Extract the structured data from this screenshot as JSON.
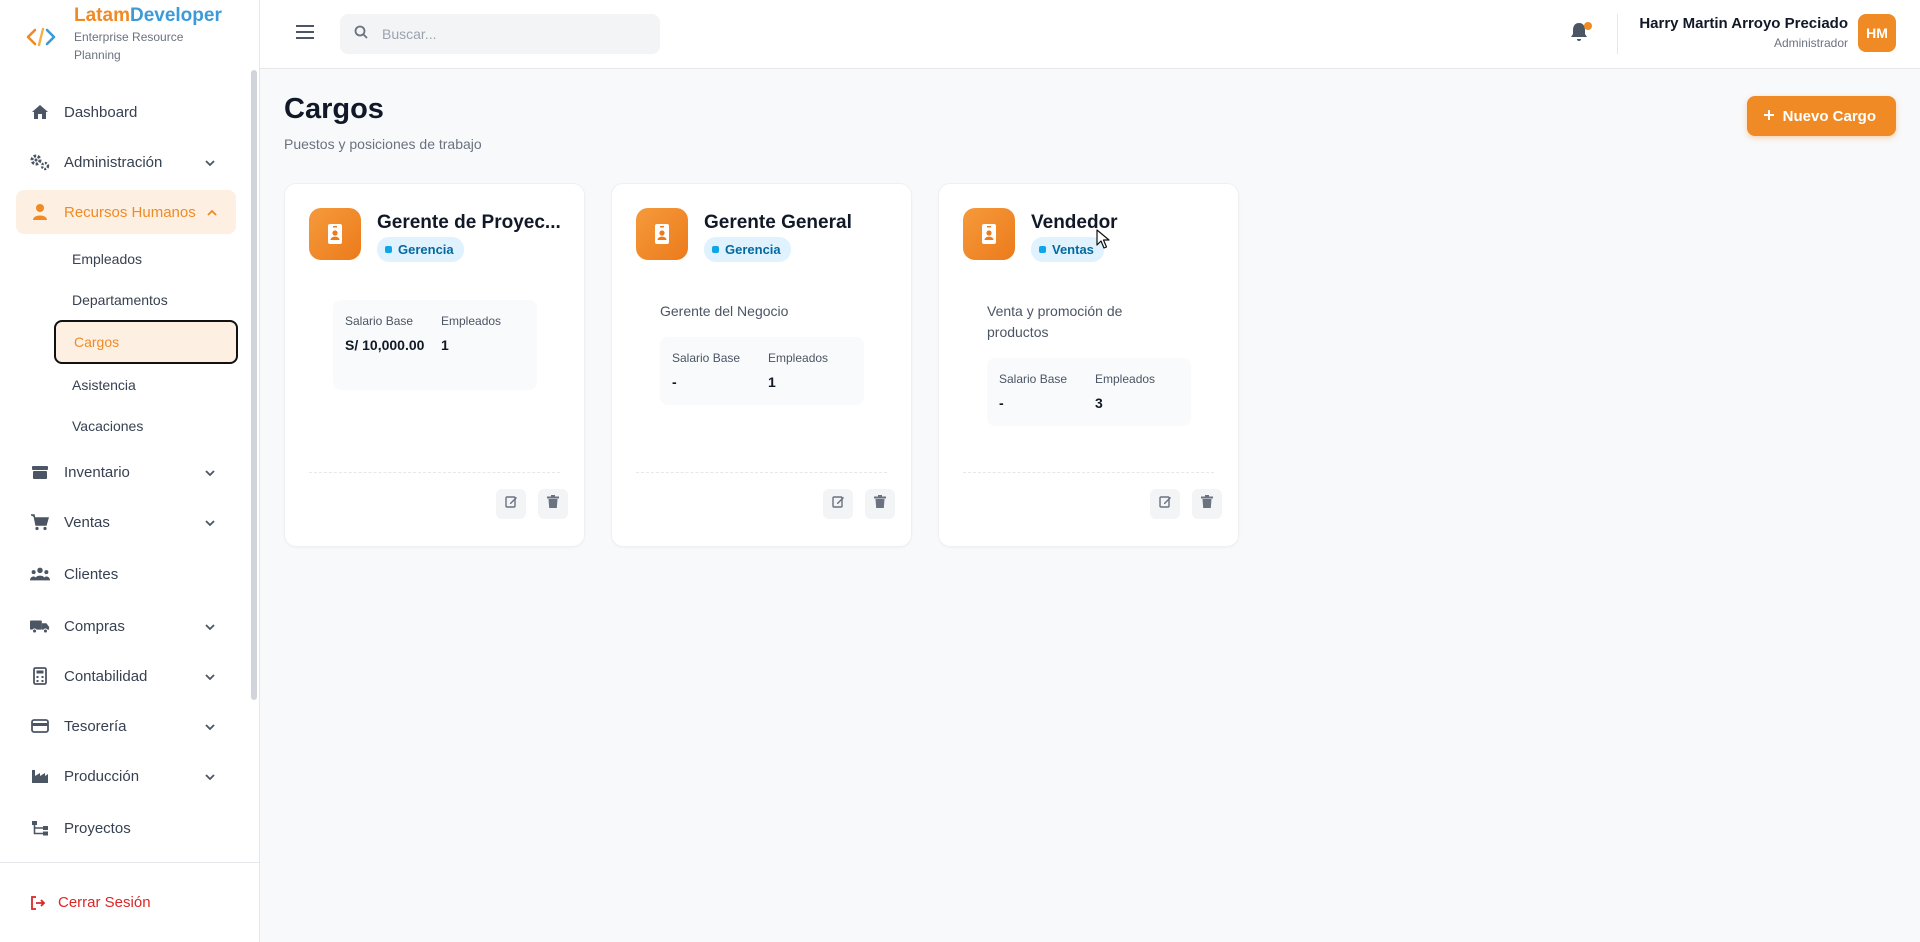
{
  "brand": {
    "name_part1": "Latam",
    "name_part2": "Developer",
    "tagline": "Enterprise Resource Planning",
    "colors": {
      "orange": "#f08a24",
      "blue": "#3b9ad9"
    }
  },
  "topbar": {
    "search_placeholder": "Buscar...",
    "user_name": "Harry Martin Arroyo Preciado",
    "user_role": "Administrador",
    "avatar_initials": "HM"
  },
  "sidebar": {
    "items": [
      {
        "label": "Dashboard",
        "icon": "home-icon"
      },
      {
        "label": "Administración",
        "icon": "gears-icon"
      },
      {
        "label": "Recursos Humanos",
        "icon": "user-icon"
      },
      {
        "label": "Inventario",
        "icon": "boxes-icon"
      },
      {
        "label": "Ventas",
        "icon": "cart-icon"
      },
      {
        "label": "Clientes",
        "icon": "users-icon"
      },
      {
        "label": "Compras",
        "icon": "truck-icon"
      },
      {
        "label": "Contabilidad",
        "icon": "calculator-icon"
      },
      {
        "label": "Tesorería",
        "icon": "wallet-icon"
      },
      {
        "label": "Producción",
        "icon": "factory-icon"
      },
      {
        "label": "Proyectos",
        "icon": "sitemap-icon"
      }
    ],
    "hr_sub": [
      "Empleados",
      "Departamentos",
      "Cargos",
      "Asistencia",
      "Vacaciones"
    ],
    "logout": "Cerrar Sesión"
  },
  "page": {
    "title": "Cargos",
    "subtitle": "Puestos y posiciones de trabajo",
    "new_button": "Nuevo Cargo"
  },
  "cards": [
    {
      "title": "Gerente de Proyec...",
      "department": "Gerencia",
      "description": "",
      "salary_label": "Salario Base",
      "salary": "S/ 10,000.00",
      "employees_label": "Empleados",
      "employees": "1"
    },
    {
      "title": "Gerente General",
      "department": "Gerencia",
      "description": "Gerente del Negocio",
      "salary_label": "Salario Base",
      "salary": "-",
      "employees_label": "Empleados",
      "employees": "1"
    },
    {
      "title": "Vendedor",
      "department": "Ventas",
      "description": "Venta y promoción de productos",
      "salary_label": "Salario Base",
      "salary": "-",
      "employees_label": "Empleados",
      "employees": "3"
    }
  ]
}
